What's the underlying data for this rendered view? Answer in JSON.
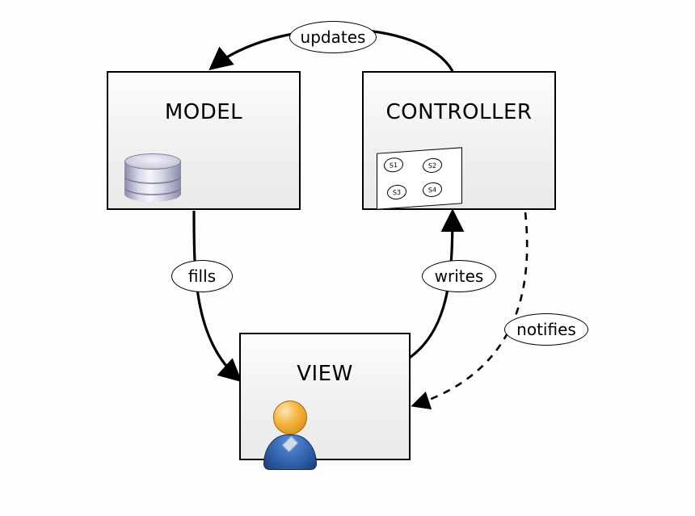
{
  "nodes": {
    "model": {
      "label": "MODEL"
    },
    "controller": {
      "label": "CONTROLLER"
    },
    "view": {
      "label": "VIEW"
    }
  },
  "edges": {
    "controller_to_model": {
      "label": "updates"
    },
    "model_to_view": {
      "label": "fills"
    },
    "view_to_controller": {
      "label": "writes"
    },
    "controller_to_view": {
      "label": "notifies"
    }
  },
  "state_machine": {
    "s1": "S1",
    "s2": "S2",
    "s3": "S3",
    "s4": "S4"
  }
}
